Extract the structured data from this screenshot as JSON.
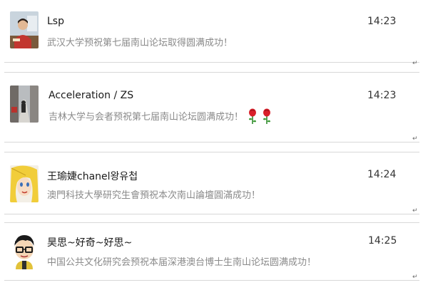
{
  "chats": [
    {
      "name": "Lsp",
      "time": "14:23",
      "message": "武汉大学预祝第七届南山论坛取得圆满成功！",
      "avatar": "photo-man-at-desk-icon"
    },
    {
      "name": "Acceleration / ZS",
      "time": "14:23",
      "message": "吉林大学与会者预祝第七届南山论坛圆满成功！",
      "avatar": "photo-street-icon",
      "emoji": [
        "rose-icon",
        "rose-icon"
      ]
    },
    {
      "name": "王瑜婕chanel왕유첩",
      "time": "14:24",
      "message": "澳門科技大學研究生會預祝本次南山論壇圓滿成功！",
      "avatar": "cartoon-blonde-girl-icon"
    },
    {
      "name": "昊思~好奇~好思~",
      "time": "14:25",
      "message": "中国公共文化研究会预祝本届深港澳台博士生南山论坛圆满成功！",
      "avatar": "cartoon-boy-glasses-icon"
    }
  ],
  "paragraph_mark": "↵",
  "colors": {
    "name": "#1a1a1a",
    "message": "#8a8a8a",
    "separator": "#d8d8d8",
    "rose": "#d9202a"
  }
}
